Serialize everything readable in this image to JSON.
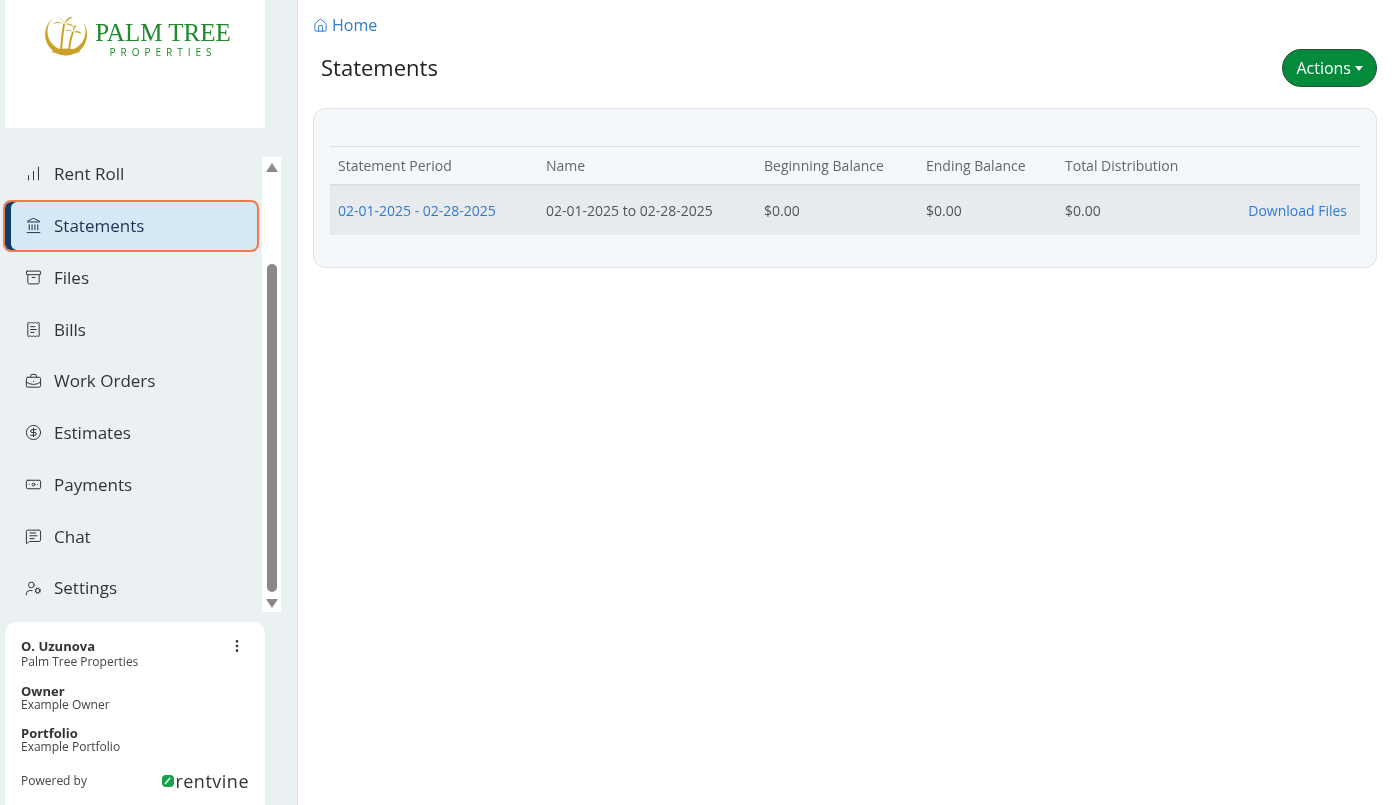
{
  "logo": {
    "title": "PALM TREE",
    "subtitle": "PROPERTIES"
  },
  "sidebar": {
    "items": [
      {
        "label": "Rent Roll",
        "selected": false
      },
      {
        "label": "Statements",
        "selected": true
      },
      {
        "label": "Files",
        "selected": false
      },
      {
        "label": "Bills",
        "selected": false
      },
      {
        "label": "Work Orders",
        "selected": false
      },
      {
        "label": "Estimates",
        "selected": false
      },
      {
        "label": "Payments",
        "selected": false
      },
      {
        "label": "Chat",
        "selected": false
      },
      {
        "label": "Settings",
        "selected": false
      }
    ]
  },
  "user_card": {
    "name": "O. Uzunova",
    "company": "Palm Tree Properties",
    "fields": [
      {
        "label": "Owner",
        "value": "Example Owner"
      },
      {
        "label": "Portfolio",
        "value": "Example Portfolio"
      }
    ],
    "powered_by": "Powered by",
    "brand": "rentvine"
  },
  "breadcrumb": "Home",
  "page_title": "Statements",
  "actions_button": "Actions",
  "table": {
    "columns": [
      "Statement Period",
      "Name",
      "Beginning Balance",
      "Ending Balance",
      "Total Distribution"
    ],
    "rows": [
      {
        "period": "02-01-2025 - 02-28-2025",
        "name": "02-01-2025 to 02-28-2025",
        "beginning": "$0.00",
        "ending": "$0.00",
        "distribution": "$0.00",
        "link": "Download Files"
      }
    ]
  }
}
